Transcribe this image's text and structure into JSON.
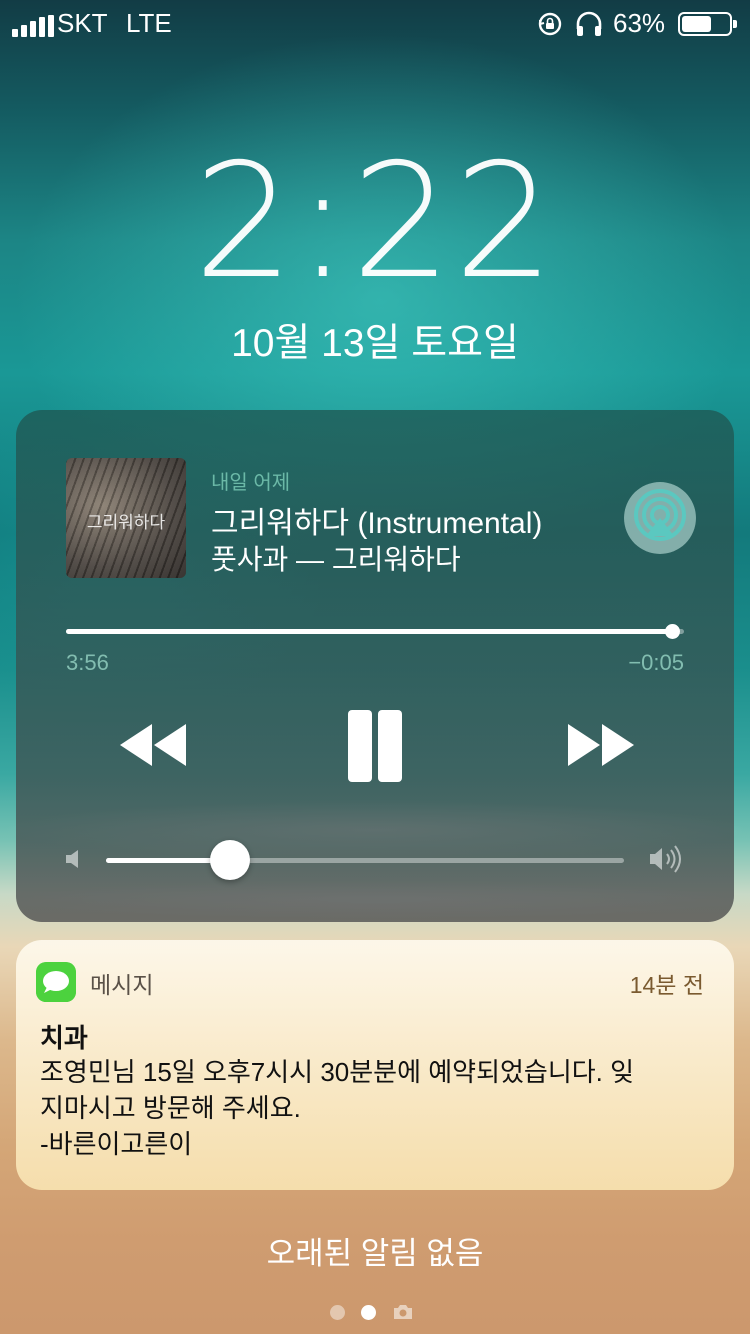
{
  "status_bar": {
    "carrier": "SKT",
    "network": "LTE",
    "battery_percent": "63%",
    "battery_level": 0.63,
    "signal_bars": 5,
    "icons": [
      "rotation-lock-icon",
      "headphones-icon",
      "battery-icon"
    ]
  },
  "lock_screen": {
    "time": "2:22",
    "date": "10월 13일 토요일"
  },
  "now_playing": {
    "station": "내일 어제",
    "title": "그리워하다 (Instrumental)",
    "subtitle": "풋사과 — 그리워하다",
    "album_art_text": "그리워하다",
    "elapsed": "3:56",
    "remaining": "−0:05",
    "progress": 0.98,
    "volume": 0.24,
    "accent_color": "#5bc8c0"
  },
  "notification": {
    "app": "메시지",
    "time_ago": "14분 전",
    "title": "치과",
    "body_lines": [
      "조영민님 15일 오후7시시 30분분에 예약되었습니다.  잊",
      "지마시고 방문해 주세요.",
      "-바른이고른이"
    ],
    "icon": "messages-icon"
  },
  "footer": {
    "no_older_notifications": "오래된 알림 없음",
    "page_dots": 3,
    "active_dot": 1
  }
}
